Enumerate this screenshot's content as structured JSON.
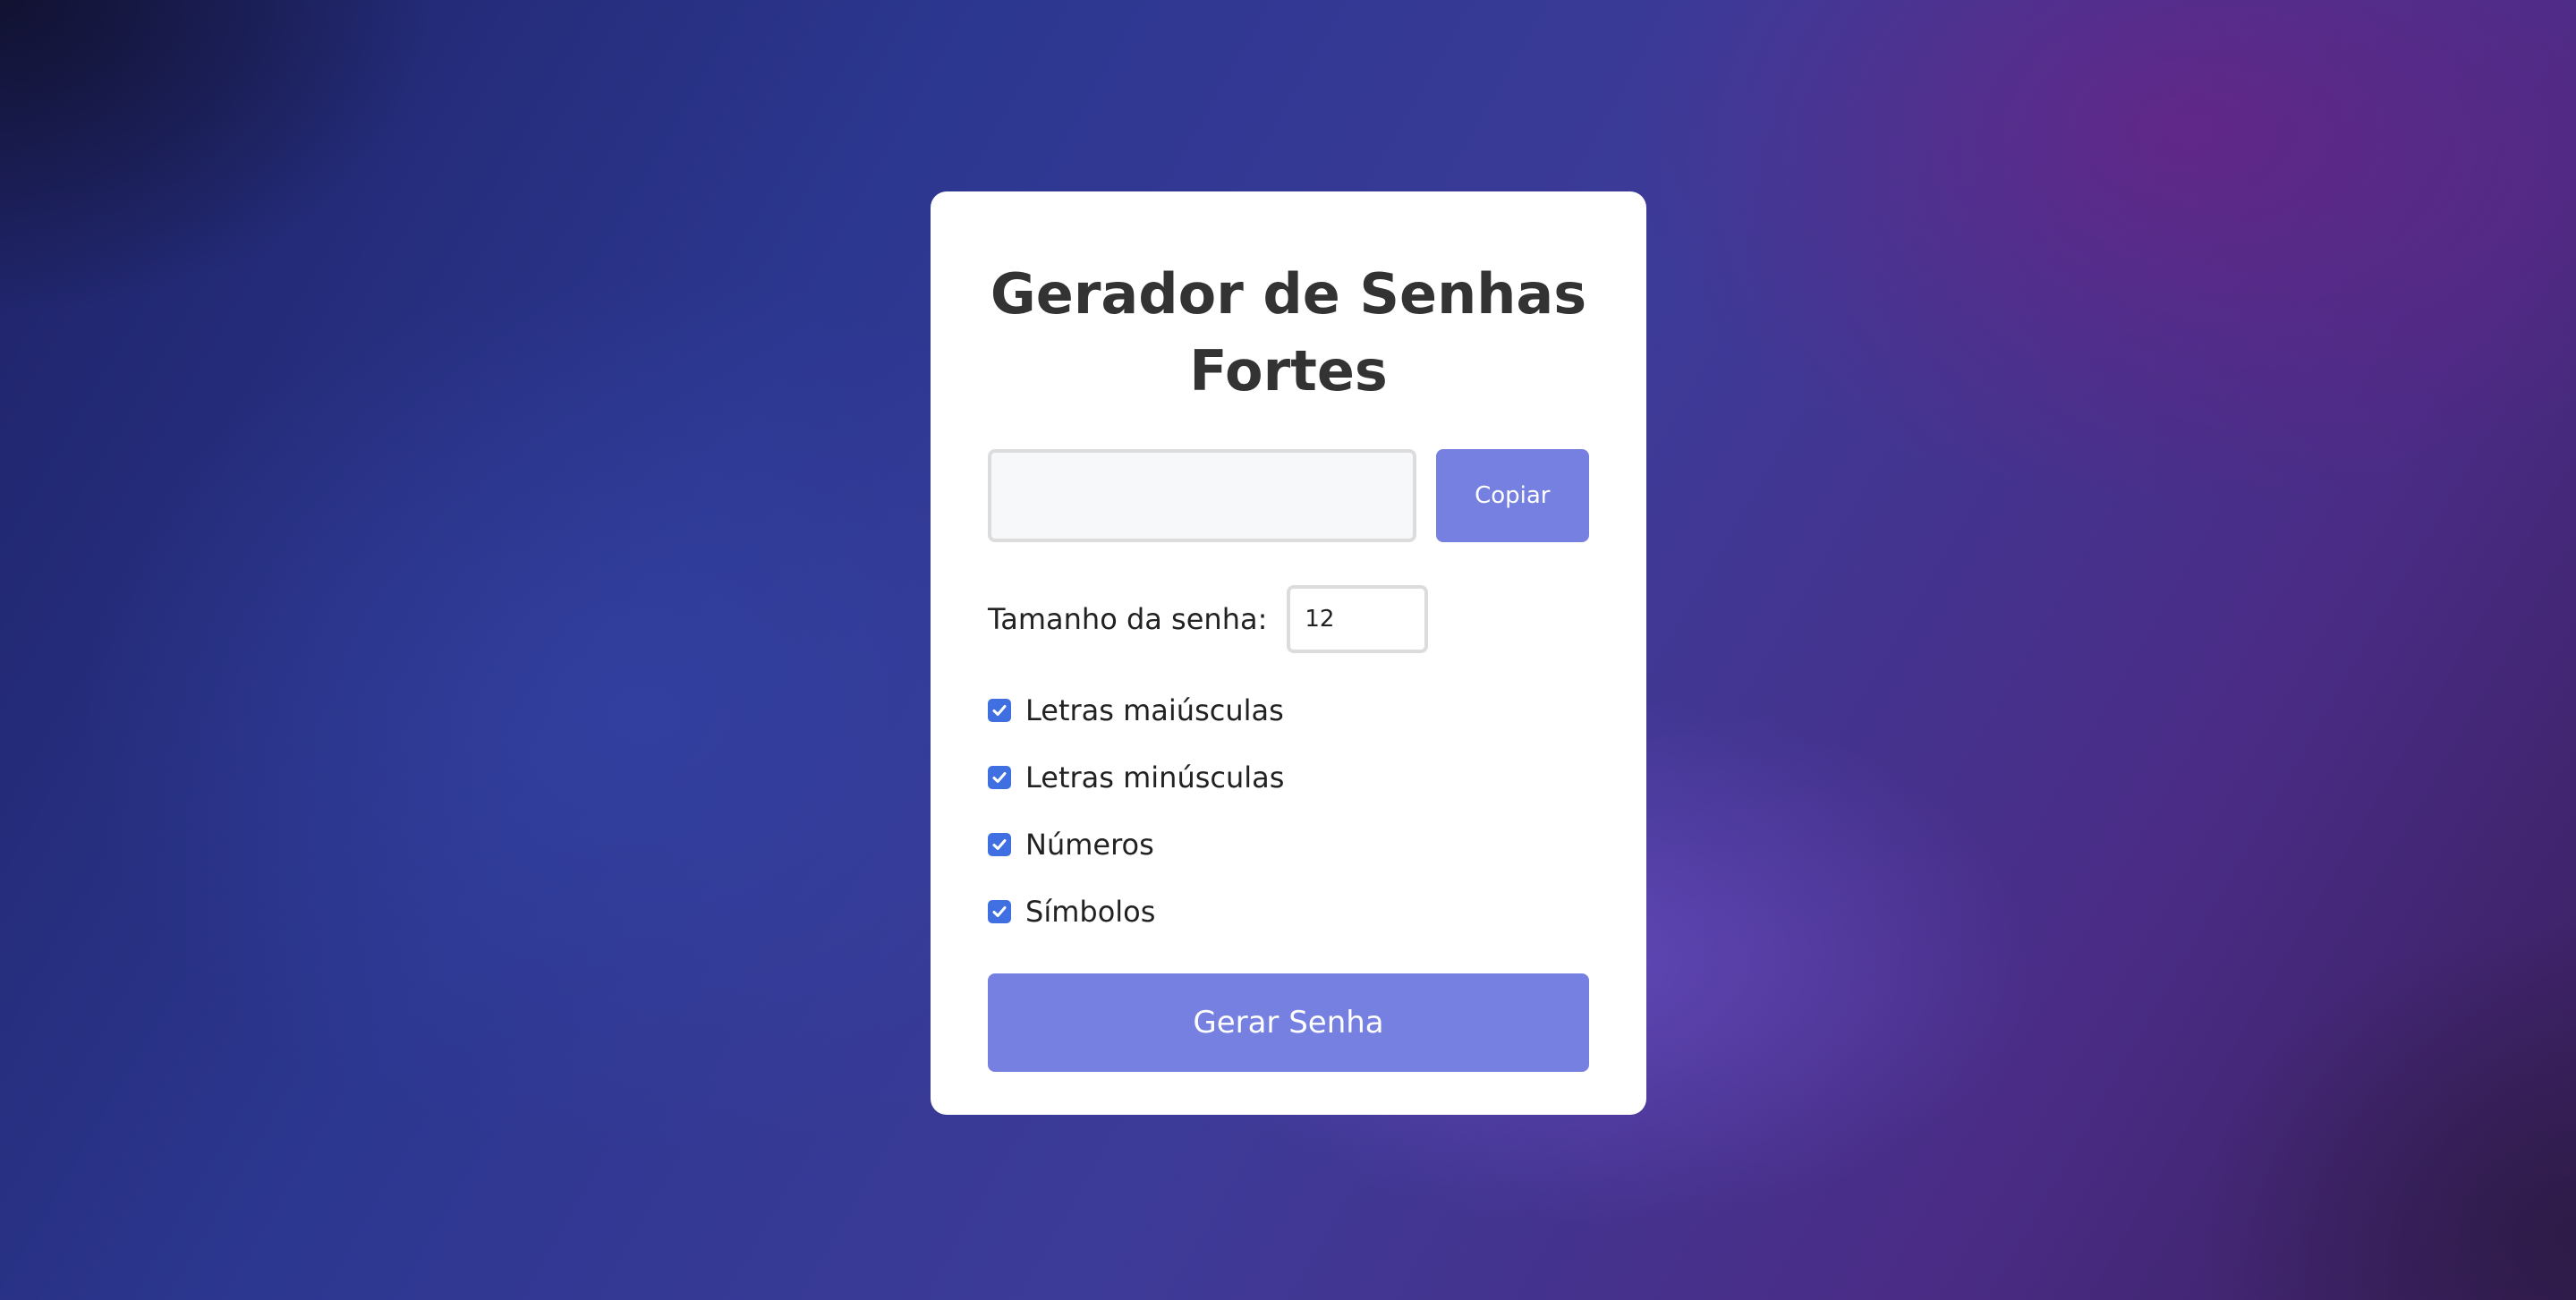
{
  "app": {
    "title": "Gerador de Senhas Fortes"
  },
  "output": {
    "password_value": "",
    "placeholder": "",
    "copy_label": "Copiar"
  },
  "length": {
    "label": "Tamanho da senha:",
    "value": "12"
  },
  "options": [
    {
      "label": "Letras maiúsculas",
      "checked": true
    },
    {
      "label": "Letras minúsculas",
      "checked": true
    },
    {
      "label": "Números",
      "checked": true
    },
    {
      "label": "Símbolos",
      "checked": true
    }
  ],
  "generate": {
    "label": "Gerar Senha"
  },
  "colors": {
    "accent": "#7580e0",
    "checkbox": "#3f6fe0",
    "title": "#333333"
  },
  "icons": {
    "checkbox_mark": "checkmark-icon"
  }
}
